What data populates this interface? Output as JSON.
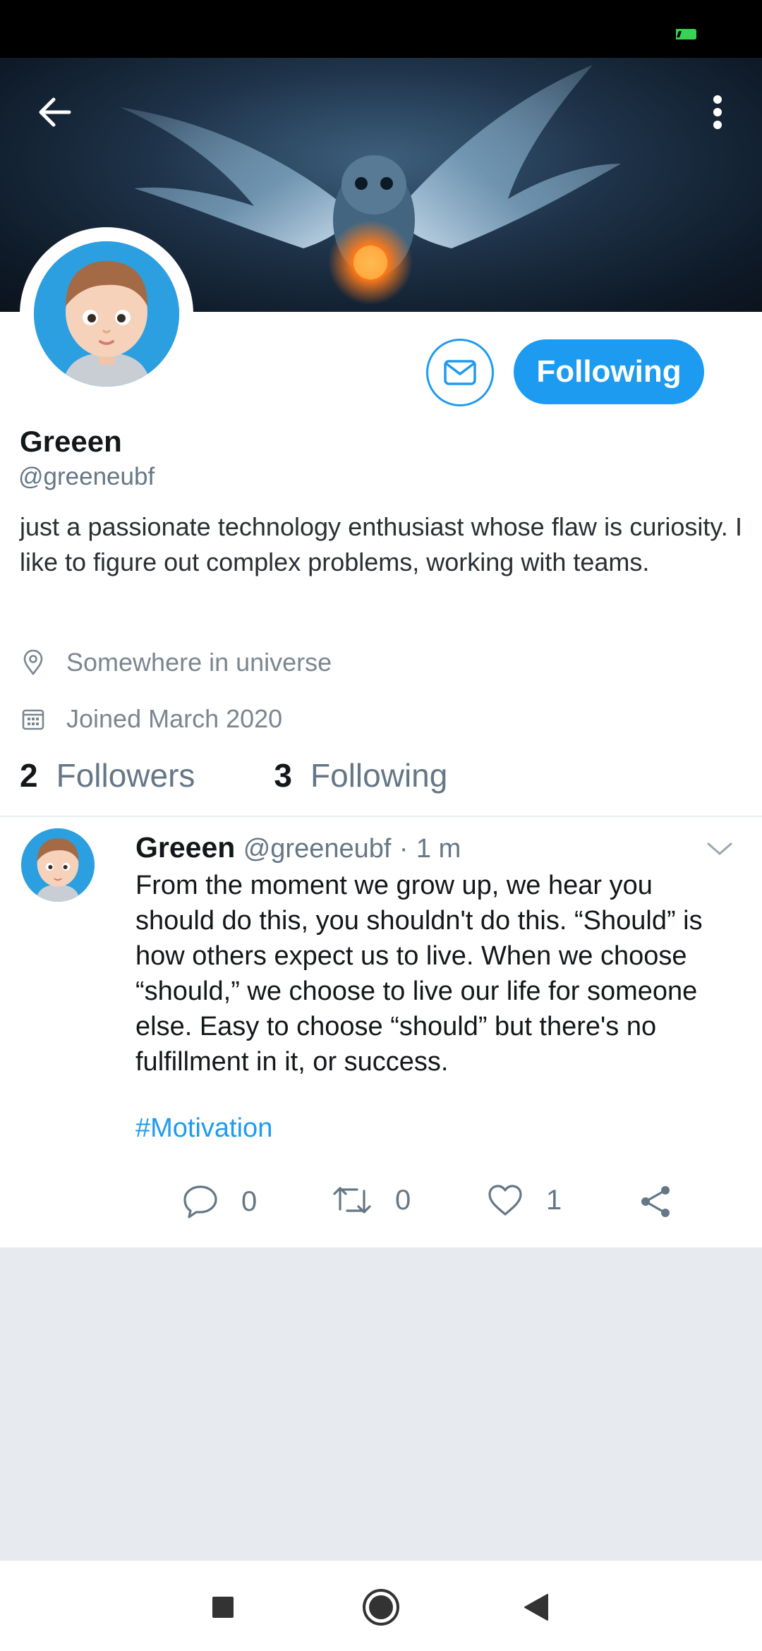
{
  "profile": {
    "display_name": "Greeen",
    "handle": "@greeneubf",
    "bio": "just a passionate technology enthusiast whose flaw is curiosity. I like to figure out complex problems, working with teams.",
    "location": "Somewhere in universe",
    "joined": "Joined March 2020",
    "followers_count": "2",
    "followers_label": "Followers",
    "following_count": "3",
    "following_label": "Following"
  },
  "actions": {
    "follow_label": "Following"
  },
  "tweet": {
    "name": "Greeen",
    "handle": "@greeneubf",
    "separator": "·",
    "time": "1 m",
    "text": "From the moment we grow up, we hear you should do this, you shouldn't do this. “Should” is how others expect us to live. When we choose “should,” we choose to live our life for someone else. Easy to choose “should” but there's no fulfillment in it, or success.",
    "hashtag": "#Motivation",
    "reply_count": "0",
    "retweet_count": "0",
    "like_count": "1"
  },
  "colors": {
    "accent": "#1d9bf0",
    "muted_text": "#657786",
    "background": "#e7ebef"
  },
  "icons": [
    "back-arrow-icon",
    "more-vertical-icon",
    "mail-icon",
    "location-pin-icon",
    "calendar-icon",
    "chevron-down-icon",
    "reply-icon",
    "retweet-icon",
    "heart-icon",
    "share-icon",
    "battery-icon"
  ]
}
